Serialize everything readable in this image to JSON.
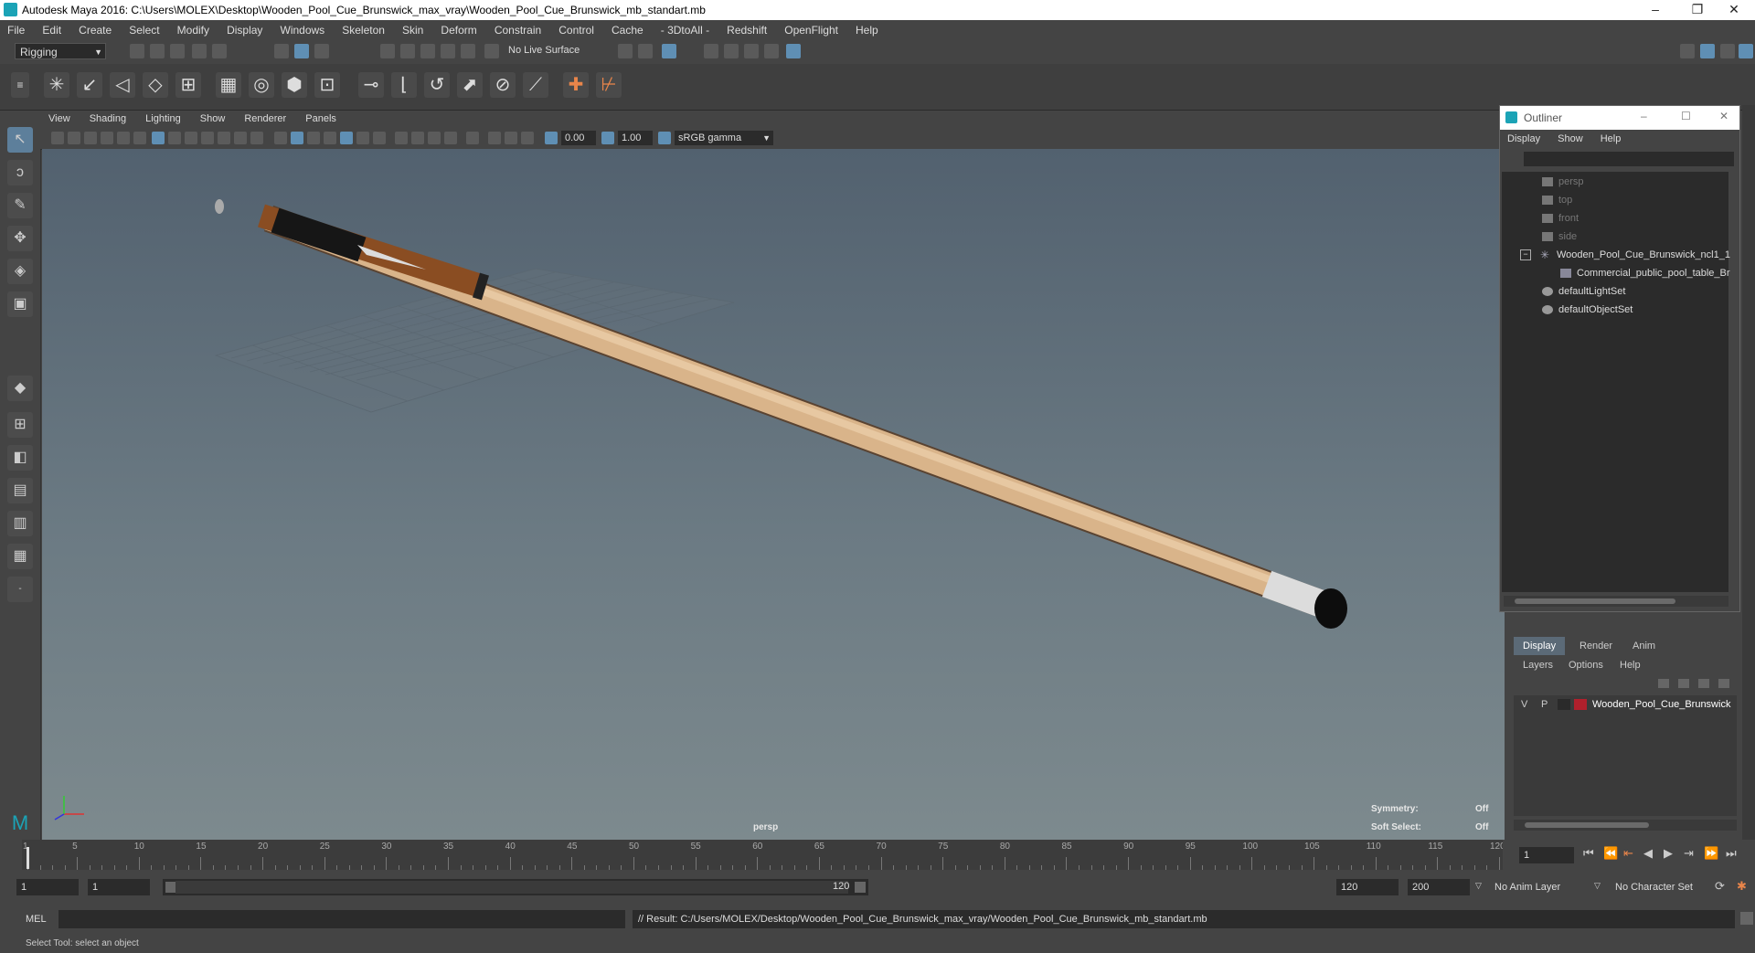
{
  "window": {
    "title": "Autodesk Maya 2016: C:\\Users\\MOLEX\\Desktop\\Wooden_Pool_Cue_Brunswick_max_vray\\Wooden_Pool_Cue_Brunswick_mb_standart.mb",
    "min": "–",
    "restore": "❐",
    "close": "✕"
  },
  "menubar": [
    "File",
    "Edit",
    "Create",
    "Select",
    "Modify",
    "Display",
    "Windows",
    "Skeleton",
    "Skin",
    "Deform",
    "Constrain",
    "Control",
    "Cache",
    "- 3DtoAll -",
    "Redshift",
    "OpenFlight",
    "Help"
  ],
  "statusline": {
    "mode": "Rigging",
    "live_surface": "No Live Surface"
  },
  "viewport": {
    "menu": [
      "View",
      "Shading",
      "Lighting",
      "Show",
      "Renderer",
      "Panels"
    ],
    "field_a": "0.00",
    "field_b": "1.00",
    "colorspace": "sRGB gamma",
    "camera_label": "persp",
    "symmetry_label": "Symmetry:",
    "symmetry_value": "Off",
    "softselect_label": "Soft Select:",
    "softselect_value": "Off"
  },
  "outliner": {
    "title": "Outliner",
    "menu": [
      "Display",
      "Show",
      "Help"
    ],
    "items": [
      {
        "label": "persp",
        "dim": true,
        "icon": "camera-icon"
      },
      {
        "label": "top",
        "dim": true,
        "icon": "camera-icon"
      },
      {
        "label": "front",
        "dim": true,
        "icon": "camera-icon"
      },
      {
        "label": "side",
        "dim": true,
        "icon": "camera-icon"
      },
      {
        "label": "Wooden_Pool_Cue_Brunswick_ncl1_1",
        "dim": false,
        "icon": "group-icon"
      },
      {
        "label": "Commercial_public_pool_table_Br",
        "dim": false,
        "icon": "mesh-icon"
      },
      {
        "label": "defaultLightSet",
        "dim": false,
        "icon": "set-icon"
      },
      {
        "label": "defaultObjectSet",
        "dim": false,
        "icon": "set-icon"
      }
    ]
  },
  "layer_editor": {
    "tabs": [
      "Display",
      "Render",
      "Anim"
    ],
    "menu": [
      "Layers",
      "Options",
      "Help"
    ],
    "layer": {
      "v": "V",
      "p": "P",
      "name": "Wooden_Pool_Cue_Brunswick",
      "color": "#b0202c"
    }
  },
  "timeline": {
    "ticks": [
      "1",
      "5",
      "10",
      "15",
      "20",
      "25",
      "30",
      "35",
      "40",
      "45",
      "50",
      "55",
      "60",
      "65",
      "70",
      "75",
      "80",
      "85",
      "90",
      "95",
      "100",
      "105",
      "110",
      "115",
      "120"
    ],
    "current_frame": "1"
  },
  "rangebar": {
    "start": "1",
    "playback_start": "1",
    "slider_start": "1",
    "slider_end": "120",
    "playback_end": "120",
    "end": "200",
    "anim_layer": "No Anim Layer",
    "character_set": "No Character Set"
  },
  "cmdline": {
    "lang": "MEL",
    "result": "// Result: C:/Users/MOLEX/Desktop/Wooden_Pool_Cue_Brunswick_max_vray/Wooden_Pool_Cue_Brunswick_mb_standart.mb"
  },
  "helpline": "Select Tool: select an object",
  "colors": {
    "accent": "#5f8fb4",
    "layer": "#b0202c",
    "cue_wood": "#d9b48a"
  }
}
